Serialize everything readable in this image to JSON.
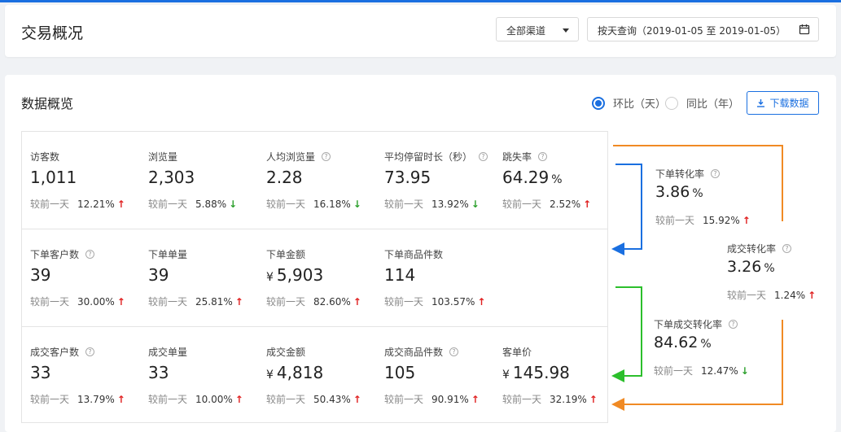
{
  "header": {
    "title": "交易概况",
    "channel_select": "全部渠道",
    "date_range": "按天查询（2019-01-05 至 2019-01-05）"
  },
  "overview": {
    "title": "数据概览",
    "radio_ring": "环比（天）",
    "radio_yoy": "同比（年）",
    "download": "下载数据"
  },
  "compare_label": "较前一天",
  "currency": "¥",
  "percent_unit": "%",
  "help_glyph": "?",
  "up_glyph": "↑",
  "down_glyph": "↓",
  "metrics": {
    "visitors": {
      "label": "访客数",
      "value": "1,011",
      "change": "12.21%"
    },
    "pageviews": {
      "label": "浏览量",
      "value": "2,303",
      "change": "5.88%"
    },
    "pv_per_visitor": {
      "label": "人均浏览量",
      "value": "2.28",
      "change": "16.18%"
    },
    "avg_stay": {
      "label": "平均停留时长（秒）",
      "value": "73.95",
      "change": "13.92%"
    },
    "bounce_rate": {
      "label": "跳失率",
      "value": "64.29",
      "change": "2.52%"
    },
    "order_customers": {
      "label": "下单客户数",
      "value": "39",
      "change": "30.00%"
    },
    "orders": {
      "label": "下单单量",
      "value": "39",
      "change": "25.81%"
    },
    "order_amount": {
      "label": "下单金额",
      "value": "5,903",
      "change": "82.60%"
    },
    "order_items": {
      "label": "下单商品件数",
      "value": "114",
      "change": "103.57%"
    },
    "deal_customers": {
      "label": "成交客户数",
      "value": "33",
      "change": "13.79%"
    },
    "deals": {
      "label": "成交单量",
      "value": "33",
      "change": "10.00%"
    },
    "deal_amount": {
      "label": "成交金额",
      "value": "4,818",
      "change": "50.43%"
    },
    "deal_items": {
      "label": "成交商品件数",
      "value": "105",
      "change": "90.91%"
    },
    "unit_price": {
      "label": "客单价",
      "value": "145.98",
      "change": "32.19%"
    }
  },
  "conversions": {
    "order_rate": {
      "label": "下单转化率",
      "value": "3.86",
      "change": "15.92%"
    },
    "deal_rate": {
      "label": "成交转化率",
      "value": "3.26",
      "change": "1.24%"
    },
    "order_deal_rate": {
      "label": "下单成交转化率",
      "value": "84.62",
      "change": "12.47%"
    }
  },
  "colors": {
    "accent": "#1a6fe0",
    "up": "#e02020",
    "down": "#2ca02c",
    "flow_orange": "#f08a24",
    "flow_blue": "#1a6fe0",
    "flow_green": "#2cbf2c"
  }
}
